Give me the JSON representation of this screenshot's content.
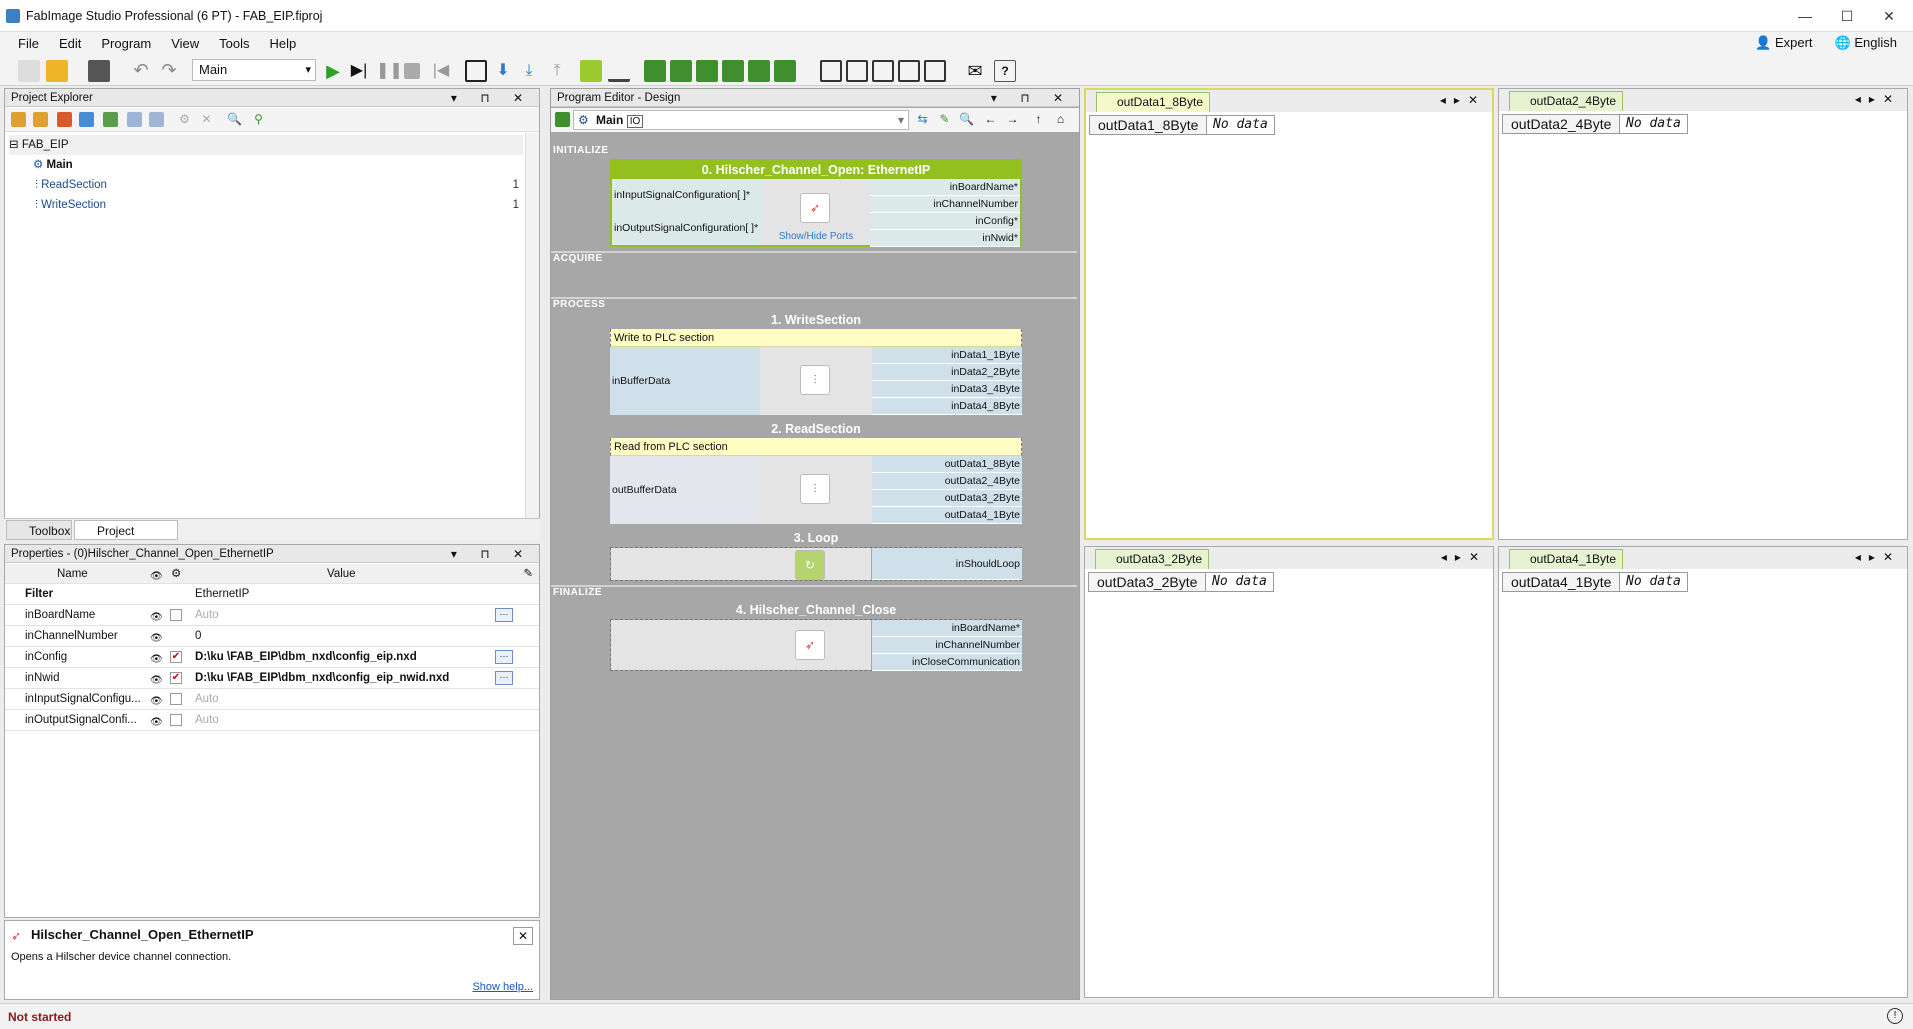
{
  "window": {
    "title": "FabImage Studio Professional (6 PT) - FAB_EIP.fiproj"
  },
  "menu": {
    "items": [
      "File",
      "Edit",
      "Program",
      "View",
      "Tools",
      "Help"
    ],
    "expert": "Expert",
    "language": "English"
  },
  "toolbar": {
    "program_select": "Main"
  },
  "project_explorer": {
    "title": "Project Explorer",
    "root": "FAB_EIP",
    "items": [
      {
        "label": "Main",
        "count": ""
      },
      {
        "label": "ReadSection",
        "count": "1"
      },
      {
        "label": "WriteSection",
        "count": "1"
      }
    ]
  },
  "bottom_tabs": {
    "toolbox": "Toolbox",
    "project_explorer": "Project Explorer"
  },
  "properties": {
    "title": "Properties - (0)Hilscher_Channel_Open_EthernetIP",
    "col_name": "Name",
    "col_value": "Value",
    "filter_label": "Filter",
    "filter_value": "EthernetIP",
    "rows": [
      {
        "name": "inBoardName",
        "value": "Auto"
      },
      {
        "name": "inChannelNumber",
        "value": "0"
      },
      {
        "name": "inConfig",
        "value": "D:\\ku \\FAB_EIP\\dbm_nxd\\config_eip.nxd"
      },
      {
        "name": "inNwid",
        "value": "D:\\ku \\FAB_EIP\\dbm_nxd\\config_eip_nwid.nxd"
      },
      {
        "name": "inInputSignalConfigu...",
        "value": "Auto"
      },
      {
        "name": "inOutputSignalConfi...",
        "value": "Auto"
      }
    ]
  },
  "help": {
    "title": "Hilscher_Channel_Open_EthernetIP",
    "description": "Opens a Hilscher device channel connection.",
    "link": "Show help..."
  },
  "status": {
    "text": "Not started"
  },
  "editor": {
    "title": "Program Editor - Design",
    "program": "Main",
    "badge": "IO",
    "sections": {
      "initialize": "INITIALIZE",
      "acquire": "ACQUIRE",
      "process": "PROCESS",
      "finalize": "FINALIZE"
    },
    "blocks": {
      "open": {
        "title": "0. Hilscher_Channel_Open: EthernetIP",
        "in": [
          "inInputSignalConfiguration[ ]*",
          "inOutputSignalConfiguration[ ]*"
        ],
        "out": [
          "inBoardName*",
          "inChannelNumber",
          "inConfig*",
          "inNwid*"
        ],
        "link": "Show/Hide Ports"
      },
      "write": {
        "title": "1. WriteSection",
        "comment": "Write to PLC section",
        "in": "inBufferData",
        "out": [
          "inData1_1Byte",
          "inData2_2Byte",
          "inData3_4Byte",
          "inData4_8Byte"
        ]
      },
      "read": {
        "title": "2. ReadSection",
        "comment": "Read from PLC section",
        "in": "outBufferData",
        "out": [
          "outData1_8Byte",
          "outData2_4Byte",
          "outData3_2Byte",
          "outData4_1Byte"
        ]
      },
      "loop": {
        "title": "3. Loop",
        "out": "inShouldLoop"
      },
      "close": {
        "title": "4. Hilscher_Channel_Close",
        "out": [
          "inBoardName*",
          "inChannelNumber",
          "inCloseCommunication"
        ]
      }
    }
  },
  "views": [
    {
      "tab": "outData1_8Byte",
      "label": "outData1_8Byte",
      "value": "No data"
    },
    {
      "tab": "outData2_4Byte",
      "label": "outData2_4Byte",
      "value": "No data"
    },
    {
      "tab": "outData3_2Byte",
      "label": "outData3_2Byte",
      "value": "No data"
    },
    {
      "tab": "outData4_1Byte",
      "label": "outData4_1Byte",
      "value": "No data"
    }
  ]
}
